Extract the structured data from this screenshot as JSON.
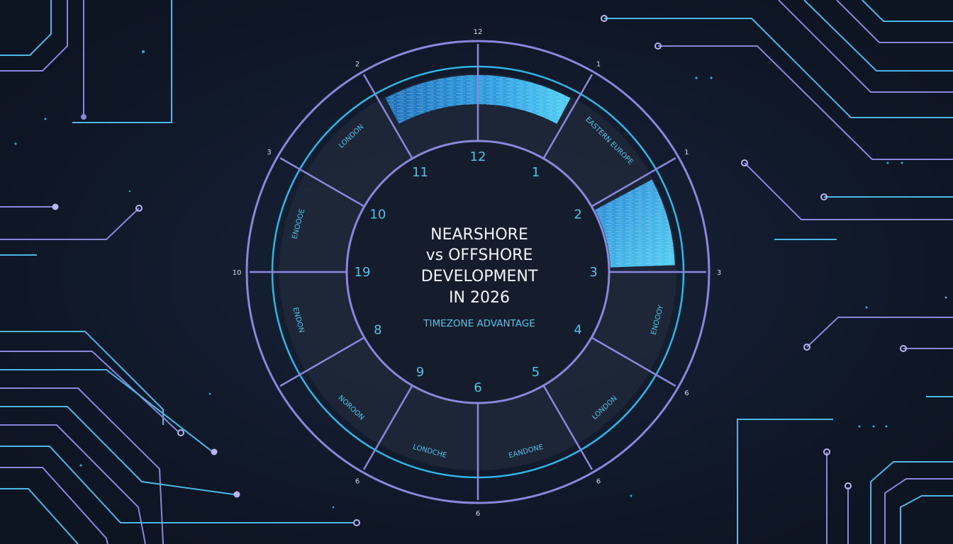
{
  "title": {
    "lines": [
      "NEARSHORE",
      "vs OFFSHORE",
      "DEVELOPMENT",
      "IN 2026"
    ]
  },
  "subtitle": "TIMEZONE ADVANTAGE",
  "inner_numbers": [
    "12",
    "1",
    "2",
    "3",
    "4",
    "5",
    "6",
    "9",
    "8",
    "19",
    "10",
    "11"
  ],
  "outer_ticks": [
    "12",
    "1",
    "1",
    "3",
    "6",
    "6",
    "6",
    "6",
    "10",
    "3",
    "2"
  ],
  "region_labels": [
    "LONDON",
    "EASTERN EUROPE",
    "ENOOOE",
    "ENDON",
    "NOROON",
    "LONDCHE",
    "EANDONE",
    "LONDON",
    "ENOOOY"
  ],
  "colors": {
    "background": "#111827",
    "accent_cyan": "#29b6e8",
    "accent_violet": "#8a86dc",
    "title_text": "#f2f4f8",
    "subtitle_text": "#4fc3ea"
  }
}
